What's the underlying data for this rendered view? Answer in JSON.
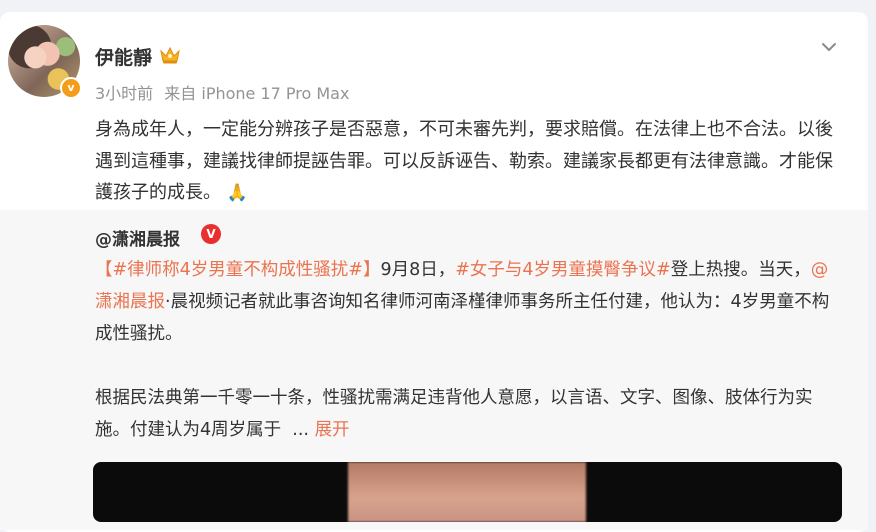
{
  "post": {
    "author": "伊能靜",
    "time": "3小时前",
    "source": "来自 iPhone 17 Pro Max",
    "text": "身為成年人，一定能分辨孩子是否惡意，不可未審先判，要求賠償。在法律上也不合法。以後遇到這種事，建議找律師提誣告罪。可以反訴诬告、勒索。建議家長都更有法律意識。才能保護孩子的成長。",
    "emoji": "🙏"
  },
  "retweet": {
    "author": "@潇湘晨报",
    "tag1": "【#律师称4岁男童不构成性骚扰#】",
    "text1": "9月8日，",
    "tag2": "#女子与4岁男童摸臀争议#",
    "text2": "登上热搜。当天，",
    "mention": "@潇湘晨报",
    "text3": "·晨视频记者就此事咨询知名律师河南泽槿律师事务所主任付建，他认为：4岁男童不构成性骚扰。",
    "para2": "根据民法典第一千零一十条，性骚扰需满足违背他人意愿，以言语、文字、图像、肢体行为实施。付建认为4周岁属于",
    "ellipsis": "...",
    "expand": "展开"
  },
  "icons": {
    "crown": "crown-icon",
    "verified": "verified-badge-icon",
    "menu": "chevron-down-icon",
    "rt_vip": "vip-v-icon"
  },
  "colors": {
    "link": "#eb7350",
    "verified": "#f59d19",
    "rt_badge": "#e8302f"
  }
}
